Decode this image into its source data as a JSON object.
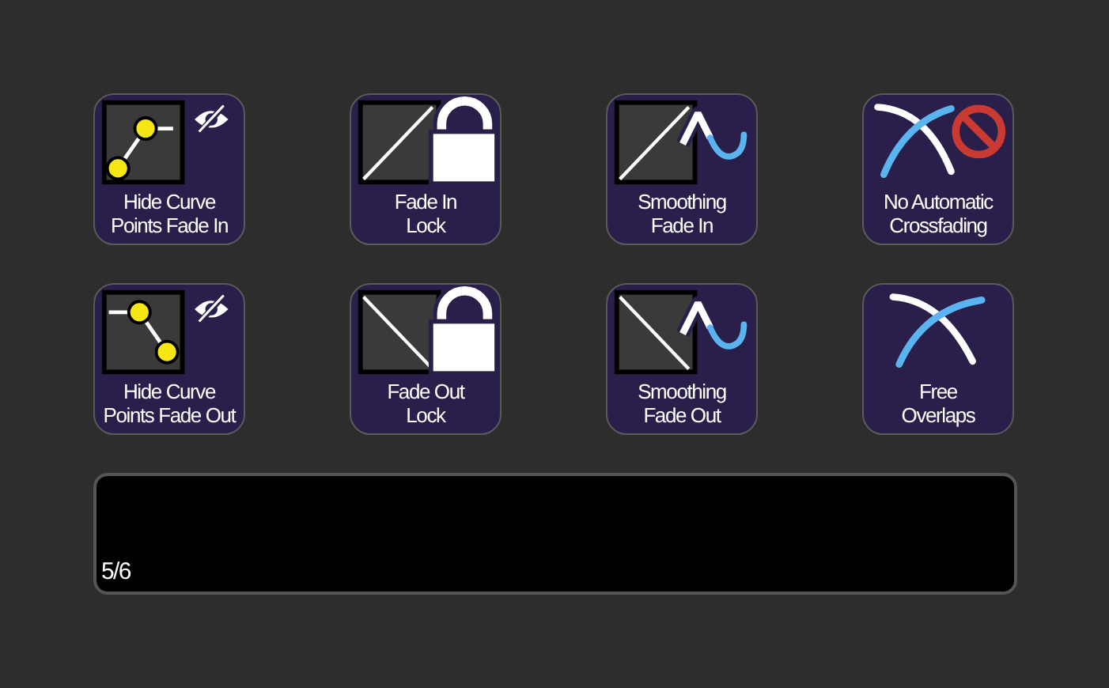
{
  "buttons": [
    {
      "kind": "hide-points-in",
      "lines": [
        "Hide Curve",
        "Points Fade In"
      ]
    },
    {
      "kind": "lock-in",
      "lines": [
        "Fade In",
        "Lock"
      ]
    },
    {
      "kind": "smooth-in",
      "lines": [
        "Smoothing",
        "Fade In"
      ]
    },
    {
      "kind": "no-crossfade",
      "lines": [
        "No Automatic",
        "Crossfading"
      ]
    },
    {
      "kind": "hide-points-out",
      "lines": [
        "Hide Curve",
        "Points Fade Out"
      ]
    },
    {
      "kind": "lock-out",
      "lines": [
        "Fade Out",
        "Lock"
      ]
    },
    {
      "kind": "smooth-out",
      "lines": [
        "Smoothing",
        "Fade Out"
      ]
    },
    {
      "kind": "overlap",
      "lines": [
        "Free",
        "Overlaps"
      ]
    }
  ],
  "display": {
    "page": "5/6"
  }
}
